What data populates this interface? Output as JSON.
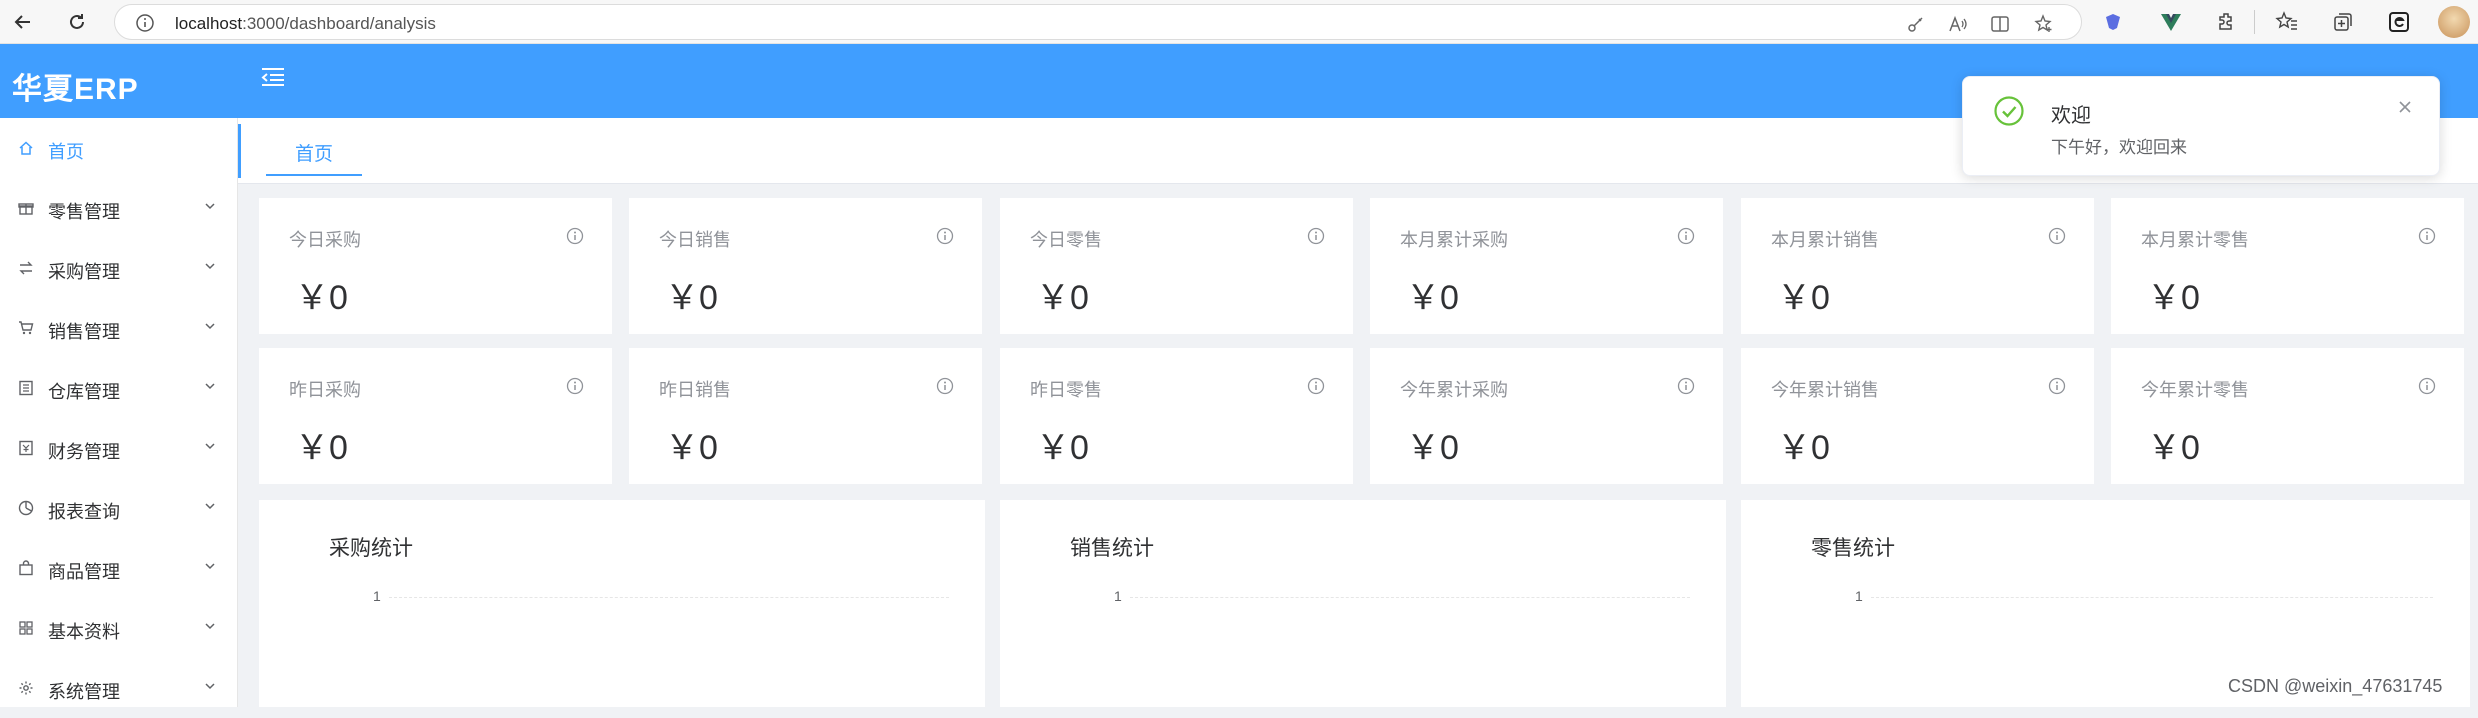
{
  "browser": {
    "url_host": "localhost",
    "url_path": ":3000/dashboard/analysis"
  },
  "header": {
    "logo": "华夏ERP"
  },
  "sidebar": {
    "items": [
      {
        "label": "首页",
        "icon": "home-icon",
        "active": true,
        "has_children": false
      },
      {
        "label": "零售管理",
        "icon": "gift-icon",
        "active": false,
        "has_children": true
      },
      {
        "label": "采购管理",
        "icon": "swap-icon",
        "active": false,
        "has_children": true
      },
      {
        "label": "销售管理",
        "icon": "cart-icon",
        "active": false,
        "has_children": true
      },
      {
        "label": "仓库管理",
        "icon": "warehouse-icon",
        "active": false,
        "has_children": true
      },
      {
        "label": "财务管理",
        "icon": "finance-icon",
        "active": false,
        "has_children": true
      },
      {
        "label": "报表查询",
        "icon": "pie-chart-icon",
        "active": false,
        "has_children": true
      },
      {
        "label": "商品管理",
        "icon": "bag-icon",
        "active": false,
        "has_children": true
      },
      {
        "label": "基本资料",
        "icon": "grid-icon",
        "active": false,
        "has_children": true
      },
      {
        "label": "系统管理",
        "icon": "gear-icon",
        "active": false,
        "has_children": true
      }
    ]
  },
  "tabs": [
    {
      "label": "首页",
      "active": true
    }
  ],
  "stats": [
    {
      "title": "今日采购",
      "value": "￥0"
    },
    {
      "title": "今日销售",
      "value": "￥0"
    },
    {
      "title": "今日零售",
      "value": "￥0"
    },
    {
      "title": "本月累计采购",
      "value": "￥0"
    },
    {
      "title": "本月累计销售",
      "value": "￥0"
    },
    {
      "title": "本月累计零售",
      "value": "￥0"
    },
    {
      "title": "昨日采购",
      "value": "￥0"
    },
    {
      "title": "昨日销售",
      "value": "￥0"
    },
    {
      "title": "昨日零售",
      "value": "￥0"
    },
    {
      "title": "今年累计采购",
      "value": "￥0"
    },
    {
      "title": "今年累计销售",
      "value": "￥0"
    },
    {
      "title": "今年累计零售",
      "value": "￥0"
    }
  ],
  "charts": [
    {
      "title": "采购统计",
      "y_tick": "1"
    },
    {
      "title": "销售统计",
      "y_tick": "1"
    },
    {
      "title": "零售统计",
      "y_tick": "1"
    }
  ],
  "notification": {
    "title": "欢迎",
    "message": "下午好，欢迎回来",
    "status_color": "#67c23a"
  },
  "watermark": "CSDN @weixin_47631745",
  "colors": {
    "primary": "#409eff",
    "success": "#67c23a"
  }
}
